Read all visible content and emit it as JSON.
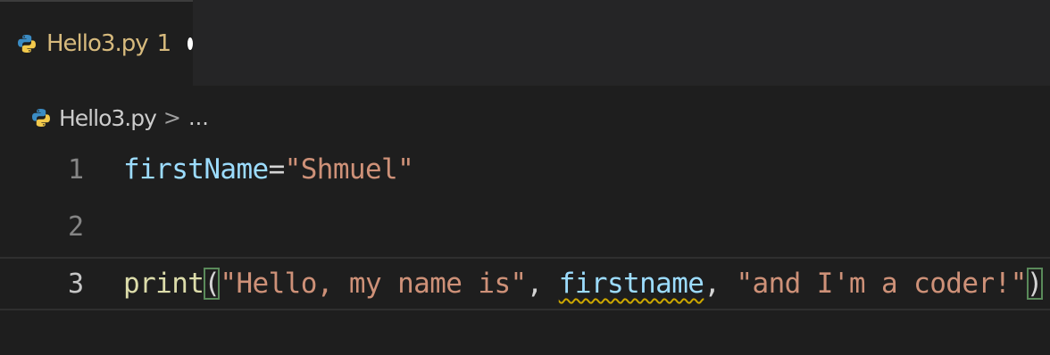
{
  "tab": {
    "label": "Hello3.py",
    "problem_count": "1",
    "icon": "python-icon",
    "unsaved": true
  },
  "breadcrumb": {
    "file": "Hello3.py",
    "separator": ">",
    "more": "..."
  },
  "editor": {
    "lines": [
      {
        "number": "1",
        "tokens": [
          {
            "text": "firstName",
            "kind": "var"
          },
          {
            "text": "=",
            "kind": "op"
          },
          {
            "text": "\"Shmuel\"",
            "kind": "str"
          }
        ]
      },
      {
        "number": "2",
        "tokens": []
      },
      {
        "number": "3",
        "tokens": [
          {
            "text": "print",
            "kind": "fn"
          },
          {
            "text": "(",
            "kind": "punc"
          },
          {
            "text": "\"Hello, my name is\"",
            "kind": "str"
          },
          {
            "text": ", ",
            "kind": "punc"
          },
          {
            "text": "firstname",
            "kind": "var"
          },
          {
            "text": ", ",
            "kind": "punc"
          },
          {
            "text": "\"and I'm a coder!\"",
            "kind": "str"
          },
          {
            "text": ")",
            "kind": "punc"
          }
        ]
      }
    ]
  },
  "colors": {
    "background": "#1e1e1e",
    "tab_label": "#d7ba7d",
    "variable": "#9cdcfe",
    "string": "#ce9178",
    "function": "#dcdcaa",
    "warning_squiggle": "#cca700"
  }
}
